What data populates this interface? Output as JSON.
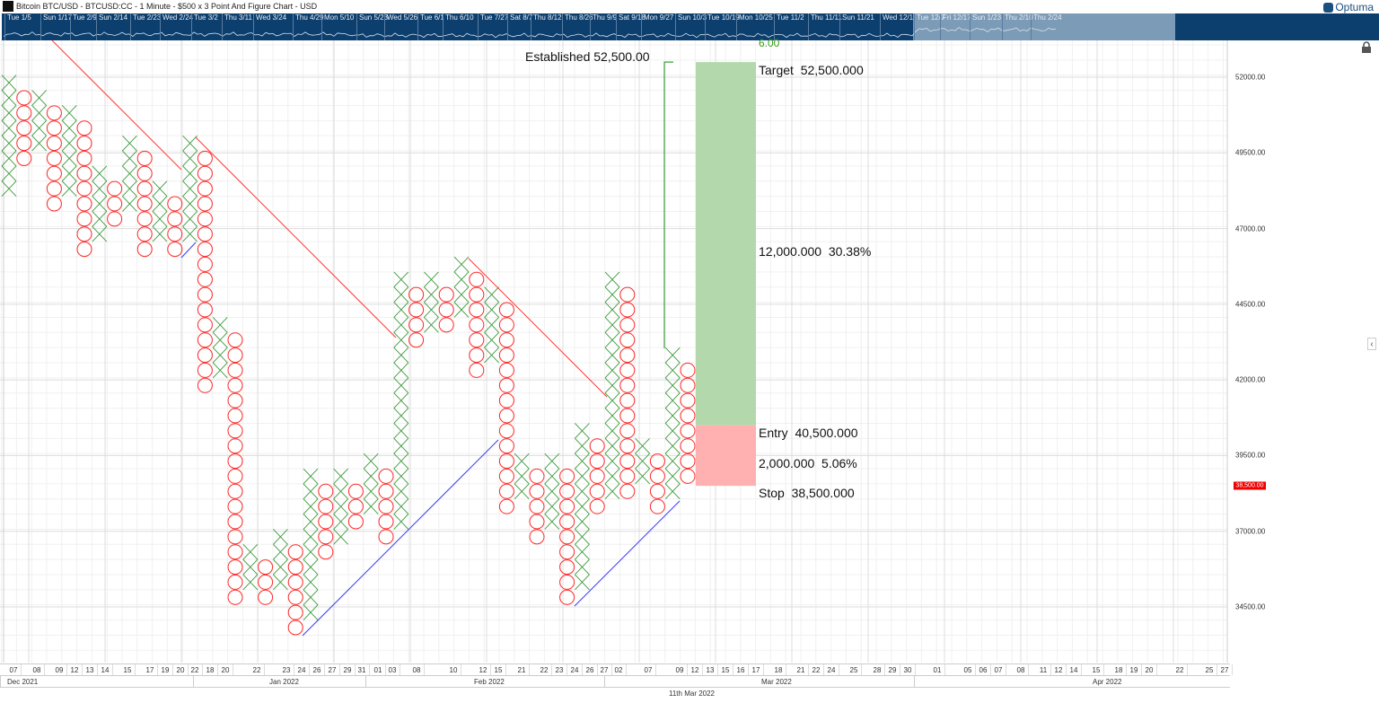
{
  "window": {
    "title": "Bitcoin BTC/USD - BTCUSD:CC - 1 Minute - $500 x 3 Point And Figure Chart - USD",
    "logo": "Optuma"
  },
  "overview": {
    "labels": [
      "Tue 1/5",
      "Sun 1/17",
      "Tue 2/9",
      "Sun 2/14",
      "Tue 2/23",
      "Wed 2/24",
      "Tue 3/2",
      "Thu 3/11",
      "Wed 3/24",
      "Thu 4/29",
      "Mon 5/10",
      "Sun 5/23",
      "Wed 5/26",
      "Tue 6/1",
      "Thu 6/10",
      "Tue 7/27",
      "Sat 8/7",
      "Thu 8/12",
      "Thu 8/26",
      "Thu 9/9",
      "Sat 9/18",
      "Mon 9/27",
      "Sun 10/3",
      "Tue 10/19",
      "Mon 10/25",
      "Tue 11/2",
      "Thu 11/11",
      "Sun 11/21",
      "Wed 12/1",
      "Tue 12/7",
      "Fri 12/17",
      "Sun 1/23",
      "Thu 2/10",
      "Thu 2/24"
    ]
  },
  "colors": {
    "x": "#3c9a3c",
    "o": "#ff2a2a",
    "target": "#b2d8ac",
    "stop": "#ffb0b0",
    "trend_down": "#ff3a3a",
    "trend_up": "#3a3aff",
    "overview": "#0c3e6e"
  },
  "chart_data": {
    "type": "point-and-figure",
    "box_size": 500,
    "reversal": 3,
    "columns": [
      {
        "t": "X",
        "lo": 48000,
        "hi": 51500
      },
      {
        "t": "O",
        "lo": 49000,
        "hi": 51000
      },
      {
        "t": "X",
        "lo": 49500,
        "hi": 51000
      },
      {
        "t": "O",
        "lo": 47500,
        "hi": 50500
      },
      {
        "t": "X",
        "lo": 48000,
        "hi": 50500
      },
      {
        "t": "O",
        "lo": 46000,
        "hi": 50000
      },
      {
        "t": "X",
        "lo": 46500,
        "hi": 48500
      },
      {
        "t": "O",
        "lo": 47000,
        "hi": 48000
      },
      {
        "t": "X",
        "lo": 47500,
        "hi": 49500
      },
      {
        "t": "O",
        "lo": 46000,
        "hi": 49000
      },
      {
        "t": "X",
        "lo": 46500,
        "hi": 48000
      },
      {
        "t": "O",
        "lo": 46000,
        "hi": 47500
      },
      {
        "t": "X",
        "lo": 46500,
        "hi": 49500
      },
      {
        "t": "O",
        "lo": 41500,
        "hi": 49000
      },
      {
        "t": "X",
        "lo": 42000,
        "hi": 43500
      },
      {
        "t": "O",
        "lo": 34500,
        "hi": 43000
      },
      {
        "t": "X",
        "lo": 35000,
        "hi": 36000
      },
      {
        "t": "O",
        "lo": 34500,
        "hi": 35500
      },
      {
        "t": "X",
        "lo": 35000,
        "hi": 36500
      },
      {
        "t": "O",
        "lo": 33500,
        "hi": 36000
      },
      {
        "t": "X",
        "lo": 34000,
        "hi": 38500
      },
      {
        "t": "O",
        "lo": 36000,
        "hi": 38000
      },
      {
        "t": "X",
        "lo": 36500,
        "hi": 38500
      },
      {
        "t": "O",
        "lo": 37000,
        "hi": 38000
      },
      {
        "t": "X",
        "lo": 37500,
        "hi": 39000
      },
      {
        "t": "O",
        "lo": 36500,
        "hi": 38500
      },
      {
        "t": "X",
        "lo": 37000,
        "hi": 45000
      },
      {
        "t": "O",
        "lo": 43000,
        "hi": 44500
      },
      {
        "t": "X",
        "lo": 43500,
        "hi": 45000
      },
      {
        "t": "O",
        "lo": 43500,
        "hi": 44500
      },
      {
        "t": "X",
        "lo": 44000,
        "hi": 45500
      },
      {
        "t": "O",
        "lo": 42000,
        "hi": 45000
      },
      {
        "t": "X",
        "lo": 42500,
        "hi": 44500
      },
      {
        "t": "O",
        "lo": 37500,
        "hi": 44000
      },
      {
        "t": "X",
        "lo": 38000,
        "hi": 39000
      },
      {
        "t": "O",
        "lo": 36500,
        "hi": 38500
      },
      {
        "t": "X",
        "lo": 37000,
        "hi": 39000
      },
      {
        "t": "O",
        "lo": 34500,
        "hi": 38500
      },
      {
        "t": "X",
        "lo": 35000,
        "hi": 40000
      },
      {
        "t": "O",
        "lo": 37500,
        "hi": 39500
      },
      {
        "t": "X",
        "lo": 38000,
        "hi": 45000
      },
      {
        "t": "O",
        "lo": 38000,
        "hi": 44500
      },
      {
        "t": "X",
        "lo": 38500,
        "hi": 39500
      },
      {
        "t": "O",
        "lo": 37500,
        "hi": 39000
      },
      {
        "t": "X",
        "lo": 38000,
        "hi": 42500
      },
      {
        "t": "O",
        "lo": 38500,
        "hi": 42000
      }
    ],
    "y_ticks": [
      "52000.00",
      "49500.00",
      "47000.00",
      "44500.00",
      "42000.00",
      "39500.00",
      "37000.00",
      "34500.00"
    ],
    "y_tick_values": [
      52000,
      49500,
      47000,
      44500,
      42000,
      39500,
      37000,
      34500
    ],
    "last_price": {
      "label": "38,500.00",
      "value": 38500
    },
    "x_day_labels": [
      "07",
      "08",
      "09",
      "12",
      "13",
      "14",
      "15",
      "17",
      "19",
      "20",
      "22",
      "18",
      "20",
      "22",
      "23",
      "24",
      "26",
      "27",
      "29",
      "31",
      "01",
      "03",
      "08",
      "10",
      "12",
      "15",
      "21",
      "22",
      "23",
      "24",
      "26",
      "27",
      "02",
      "07",
      "09",
      "12",
      "13",
      "15",
      "16",
      "17",
      "18",
      "21",
      "22",
      "24",
      "25",
      "28",
      "29",
      "30",
      "01",
      "05",
      "06",
      "07",
      "08",
      "11",
      "12",
      "14",
      "15",
      "18",
      "19",
      "20",
      "22",
      "25",
      "27"
    ],
    "x_month_labels": [
      "Dec 2021",
      "Jan 2022",
      "Feb 2022",
      "Mar 2022",
      "Apr 2022"
    ],
    "cursor_date": "11th Mar 2022",
    "trade": {
      "established_label": "Established 52,500.00",
      "count_label": "6.00",
      "target_label": "Target  52,500.000",
      "target": 52500,
      "reward_label": "12,000.000  30.38%",
      "entry_label": "Entry  40,500.000",
      "entry": 40500,
      "risk_label": "2,000.000  5.06%",
      "stop_label": "Stop  38,500.000",
      "stop": 38500
    }
  }
}
